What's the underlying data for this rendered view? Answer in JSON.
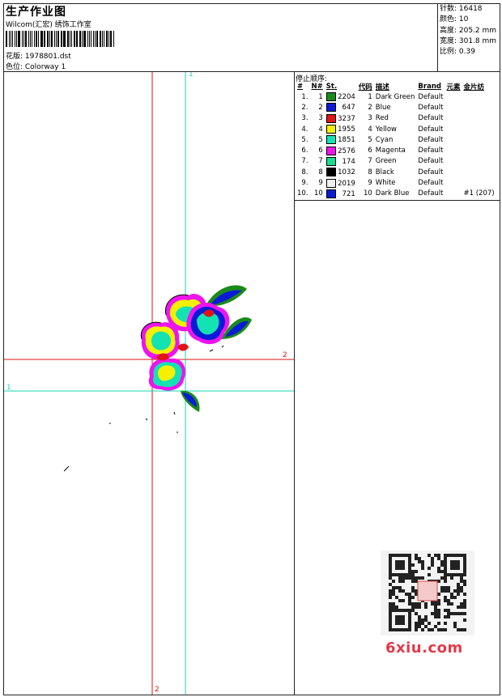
{
  "header": {
    "title": "生产作业图",
    "company": "Wilcom(汇宏) 绣饰工作室",
    "design_label": "花版: 1978801.dst",
    "colorway_label": "色位: Colorway 1"
  },
  "stats": {
    "stitches": "针数: 16418",
    "colors": "颜色: 10",
    "height": "高度: 205.2 mm",
    "width": "宽度: 301.8 mm",
    "scale": "比例: 0.39"
  },
  "stop_table": {
    "title": "停止顺序:",
    "headers": [
      "#",
      "N#",
      "St.",
      "代码",
      "描述",
      "Brand",
      "元素",
      "金片纺"
    ],
    "rows": [
      {
        "idx": "1.",
        "n": "1",
        "color": "#1a8a1a",
        "st": "2204",
        "code": "1",
        "desc": "Dark Green",
        "brand": "Default",
        "extra": ""
      },
      {
        "idx": "2.",
        "n": "2",
        "color": "#0a1ad8",
        "st": "647",
        "code": "2",
        "desc": "Blue",
        "brand": "Default",
        "extra": ""
      },
      {
        "idx": "3.",
        "n": "3",
        "color": "#e01414",
        "st": "3237",
        "code": "3",
        "desc": "Red",
        "brand": "Default",
        "extra": ""
      },
      {
        "idx": "4.",
        "n": "4",
        "color": "#f5f000",
        "st": "1955",
        "code": "4",
        "desc": "Yellow",
        "brand": "Default",
        "extra": ""
      },
      {
        "idx": "5.",
        "n": "5",
        "color": "#13e3b3",
        "st": "1851",
        "code": "5",
        "desc": "Cyan",
        "brand": "Default",
        "extra": ""
      },
      {
        "idx": "6.",
        "n": "6",
        "color": "#ee14ee",
        "st": "2576",
        "code": "6",
        "desc": "Magenta",
        "brand": "Default",
        "extra": ""
      },
      {
        "idx": "7.",
        "n": "7",
        "color": "#14e08f",
        "st": "174",
        "code": "7",
        "desc": "Green",
        "brand": "Default",
        "extra": ""
      },
      {
        "idx": "8.",
        "n": "8",
        "color": "#000000",
        "st": "1032",
        "code": "8",
        "desc": "Black",
        "brand": "Default",
        "extra": ""
      },
      {
        "idx": "9.",
        "n": "9",
        "color": "#f0f0f0",
        "st": "2019",
        "code": "9",
        "desc": "White",
        "brand": "Default",
        "extra": ""
      },
      {
        "idx": "10.",
        "n": "10",
        "color": "#0a1ad8",
        "st": "721",
        "code": "10",
        "desc": "Dark Blue",
        "brand": "Default",
        "extra": "#1 (207)"
      }
    ]
  },
  "guides": {
    "red_h_label": "2",
    "red_v_label": "2",
    "cyan_h_label": "1",
    "cyan_v_label": "1",
    "red_color": "#e01010",
    "cyan_color": "#19d6b0"
  },
  "watermark": "6xiu.com"
}
